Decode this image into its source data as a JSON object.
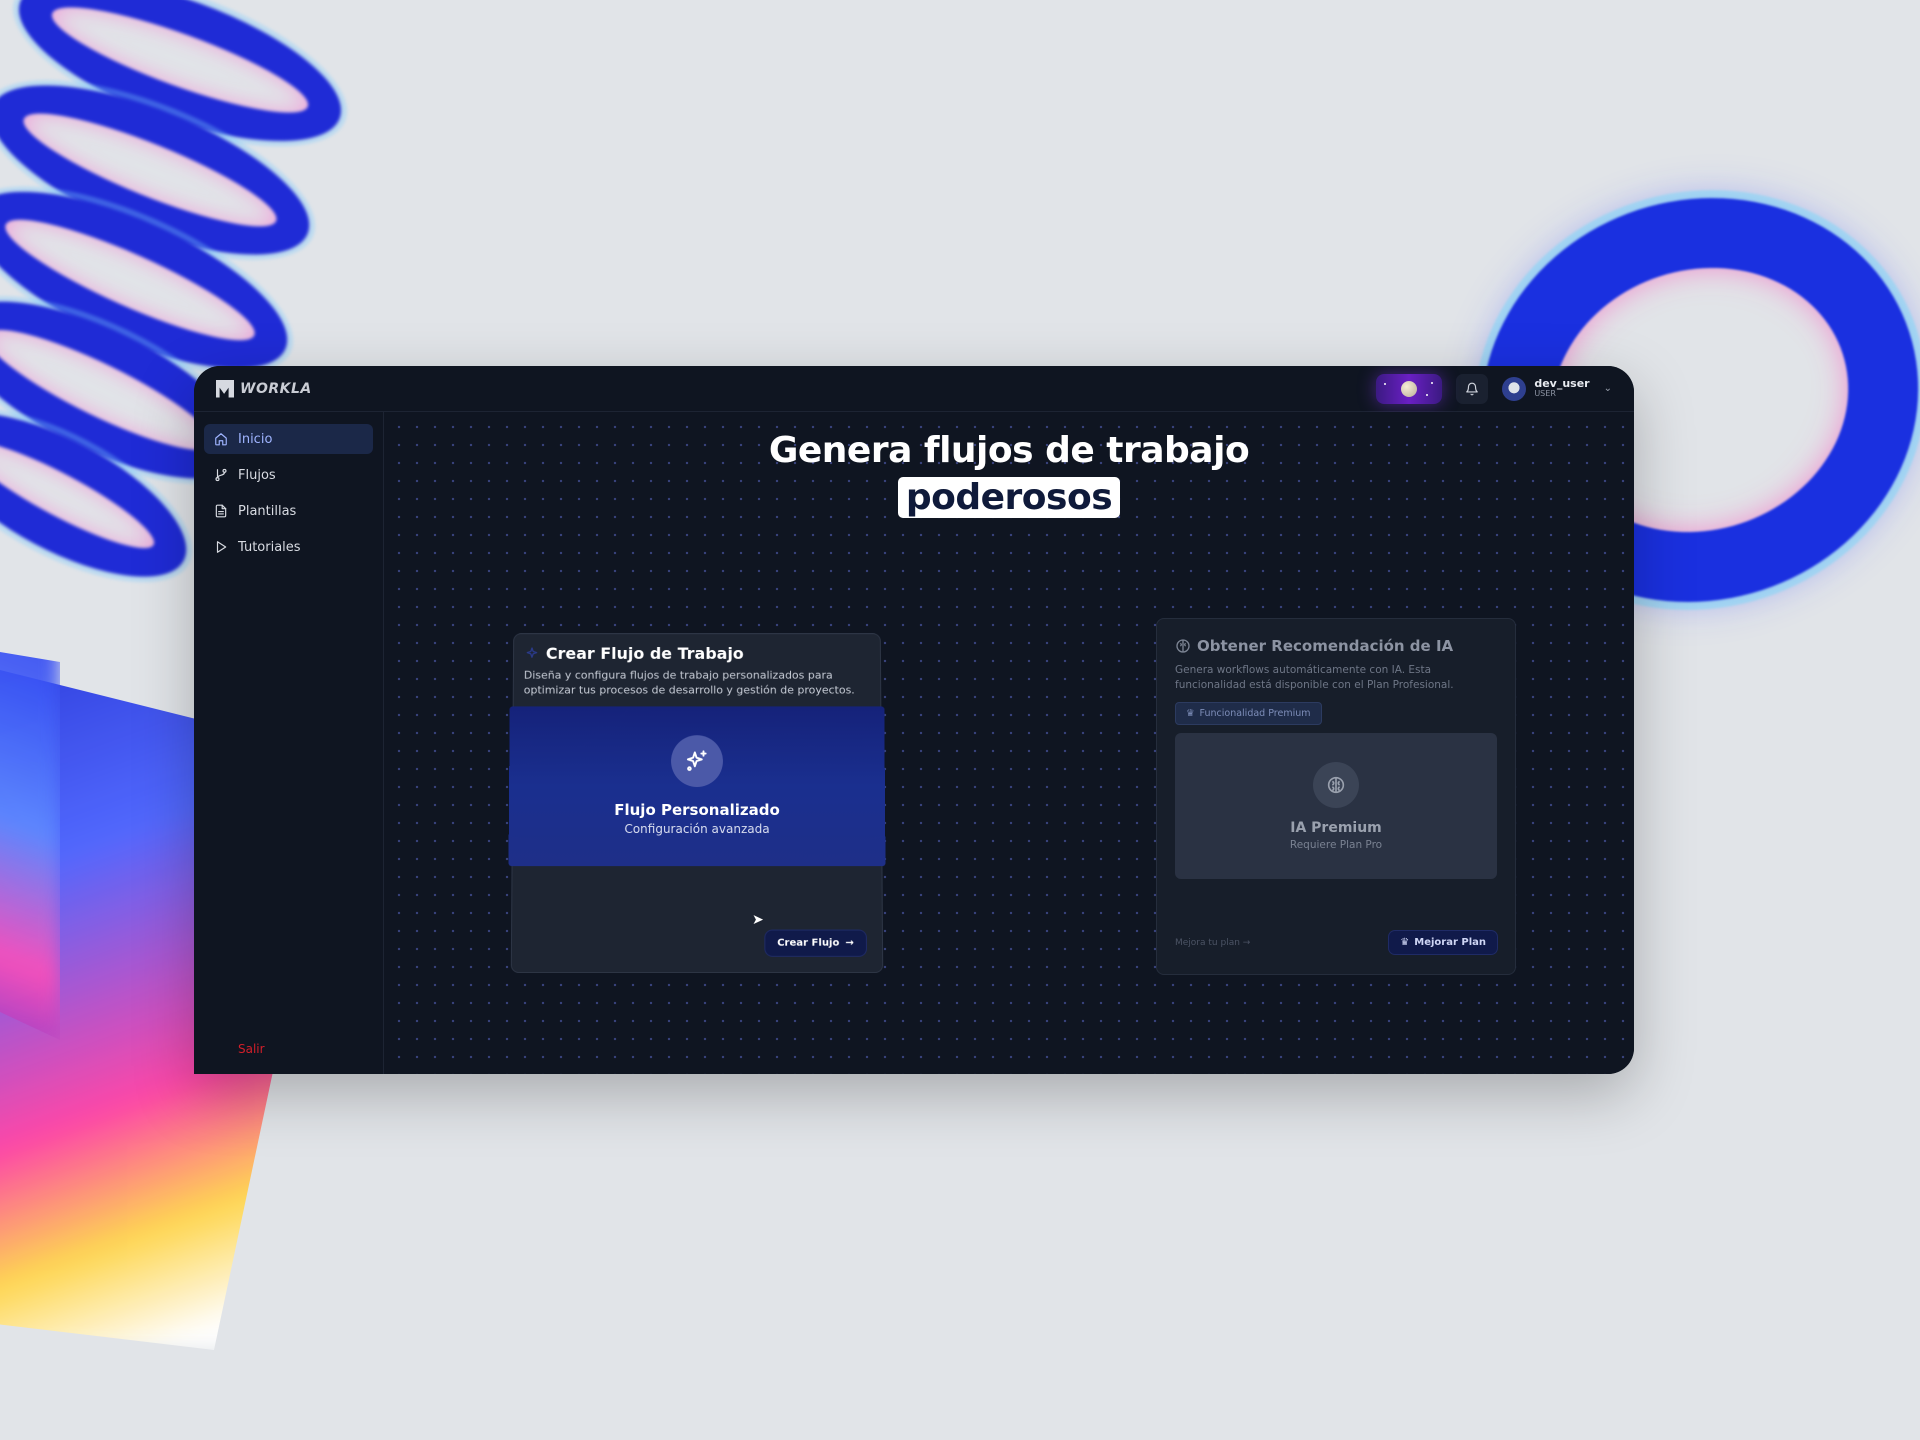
{
  "app": {
    "logo_text": "WORKLA"
  },
  "header": {
    "user_name": "dev_user",
    "user_role": "USER"
  },
  "sidebar": {
    "items": [
      {
        "label": "Inicio",
        "icon": "home-icon",
        "active": true
      },
      {
        "label": "Flujos",
        "icon": "git-branch-icon",
        "active": false
      },
      {
        "label": "Plantillas",
        "icon": "document-icon",
        "active": false
      },
      {
        "label": "Tutoriales",
        "icon": "play-icon",
        "active": false
      }
    ],
    "logout_label": "Salir"
  },
  "hero": {
    "line1": "Genera flujos de trabajo",
    "highlight": "poderosos"
  },
  "create_card": {
    "title": "Crear Flujo de Trabajo",
    "description": "Diseña y configura flujos de trabajo personalizados para optimizar tus procesos de desarrollo y gestión de proyectos.",
    "feature_title": "Flujo Personalizado",
    "feature_subtitle": "Configuración avanzada",
    "button_label": "Crear Flujo"
  },
  "ai_card": {
    "title": "Obtener Recomendación de IA",
    "description": "Genera workflows automáticamente con IA. Esta funcionalidad está disponible con el Plan Profesional.",
    "badge": "Funcionalidad Premium",
    "feature_title": "IA Premium",
    "feature_subtitle": "Requiere Plan Pro",
    "upgrade_link": "Mejora tu plan →",
    "button_label": "Mejorar Plan"
  },
  "colors": {
    "window_bg": "#0f1521",
    "accent": "#101a4a",
    "active_nav": "#1b2848",
    "logout": "#d21f2a",
    "page_bg": "#e1e4e8"
  }
}
